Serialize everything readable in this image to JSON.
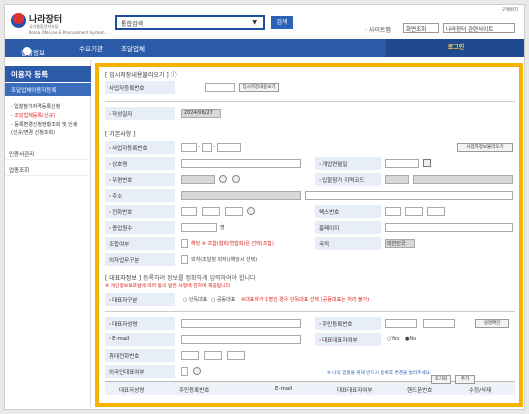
{
  "header": {
    "logo_title": "나라장터",
    "logo_sub_ko": "국가종합전자조달",
    "logo_sub_en": "Korea ON-Line E-Procurement System",
    "search_select": "통합검색",
    "search_button": "검색",
    "top_right": "구매위치",
    "sitemap": "· 사이트맵",
    "select_mode": "화면조회",
    "select_site": "나라장터 관련사이트"
  },
  "nav": {
    "items": [
      "입찰정보",
      "수요기관",
      "조달업체"
    ],
    "login": "로그인"
  },
  "sidebar": {
    "title": "이용자 등록",
    "sub": "조달업체이용자등록",
    "items": [
      "· 입찰참가자격등록신청",
      "- 조달업체등록(신규)",
      "- 등록변경신청현황조회 및 인쇄",
      "  (신규/변경 신청조회)"
    ],
    "groups": [
      "인증서관리",
      "업종조회"
    ]
  },
  "form": {
    "sec_temp": "[ 임시저장내용불러오기 ]",
    "biz_reg_label": "사업자등록번호",
    "temp_load_btn": "임시저장내용보기",
    "date_label": "작성일자",
    "date_value": "2024/06/27",
    "sec_basic": "[ 기본사항 ]",
    "biz_no_label": "사업자등록번호",
    "verify_btn": "사업자정보불러오기",
    "name_label": "상호명",
    "open_date_label": "개업연월일",
    "zip_label": "우편번호",
    "region_label": "입찰참가 지역코드",
    "addr_label": "주소",
    "tel_label": "전화번호",
    "fax_label": "팩스번호",
    "emp_label": "종업원수",
    "emp_unit": "명",
    "home_label": "홈페이지",
    "co_label": "조합여부",
    "co_text": "해당 ※ 조합(협회/연합회)은 선택(조합)",
    "country_label": "국적",
    "country_value": "대한민국",
    "foreign_label": "외자업무구분",
    "foreign_text": "외자(조달청 외자)(해당시 선택)",
    "sec_rep": "[ 대표자정보 ]",
    "rep_note1": "등록하려 정보를 정확하게 입력하여야 합니다",
    "rep_note2": "※ 개인정보보호법에 따라 동의 받은 사항에 한하여 제공됩니다",
    "rep_type_label": "대표자구분",
    "rep_type_opts": [
      "단독대표",
      "공동대표"
    ],
    "rep_type_note": "※대표자가 1명인 경우 단독대표 선택 (공동대표는 처리 불가)",
    "rep_name_label": "대표자성명",
    "rrn_label": "주민등록번호",
    "real_name_btn": "실명확인",
    "email_label": "E-mail",
    "main_rep_label": "대표대표자여부",
    "main_rep_opts": [
      "Yes",
      "No"
    ],
    "mobile_label": "휴대전화번호",
    "foreign_rep_label": "외국인대표여부",
    "bottom_note": "※ 나의 입찰을 위해 반드시 등록후 변경을 눌러주세요.",
    "reset_btn": "초기화",
    "add_btn": "추가"
  },
  "table": {
    "headers": [
      "대표자성명",
      "주민등록번호",
      "E-mail",
      "대표대표자여부",
      "핸드폰번호",
      "수정/삭제"
    ]
  }
}
